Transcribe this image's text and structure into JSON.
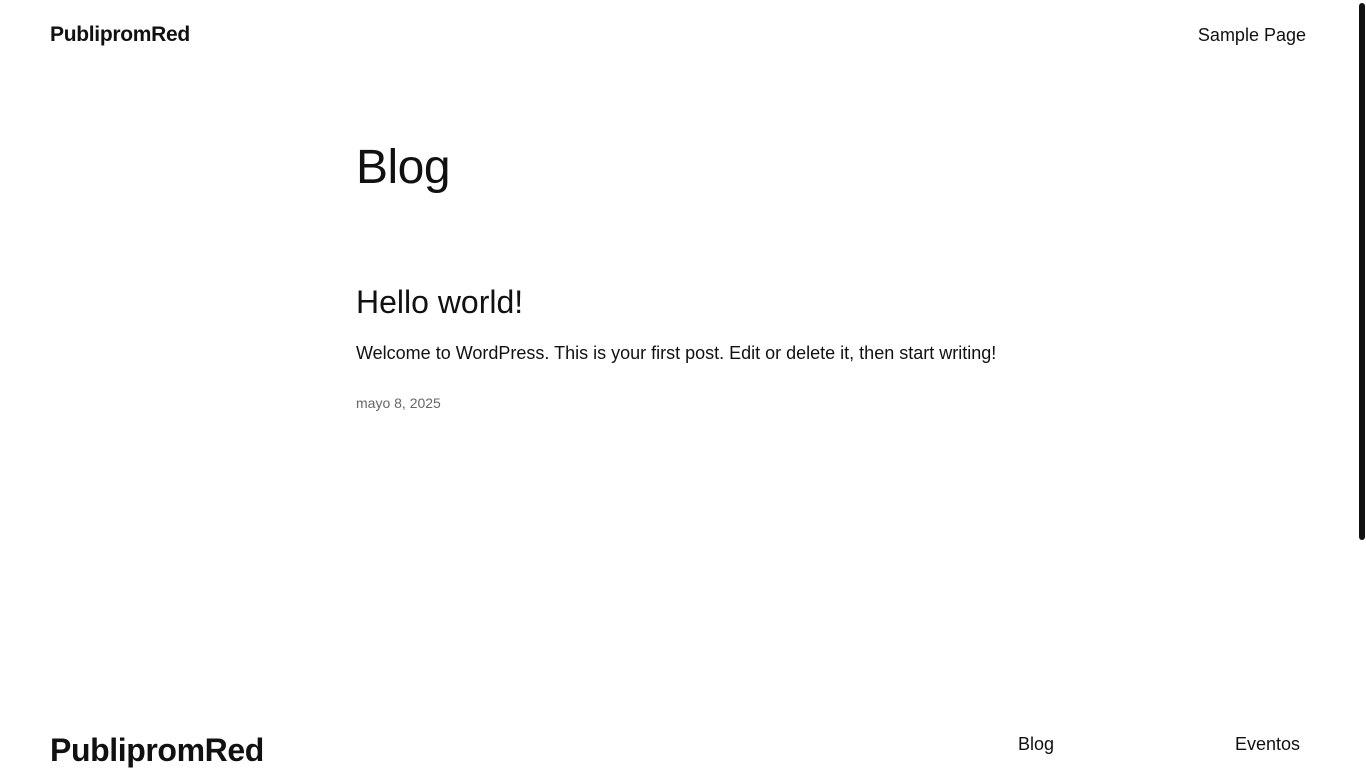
{
  "header": {
    "site_title": "PublipromRed",
    "nav_items": [
      {
        "label": "Sample Page"
      }
    ]
  },
  "main": {
    "page_title": "Blog",
    "posts": [
      {
        "title": "Hello world!",
        "excerpt": "Welcome to WordPress. This is your first post. Edit or delete it, then start writing!",
        "date": "mayo 8, 2025"
      }
    ]
  },
  "footer": {
    "site_title": "PublipromRed",
    "links": [
      {
        "label": "Blog"
      },
      {
        "label": "Eventos"
      }
    ]
  }
}
